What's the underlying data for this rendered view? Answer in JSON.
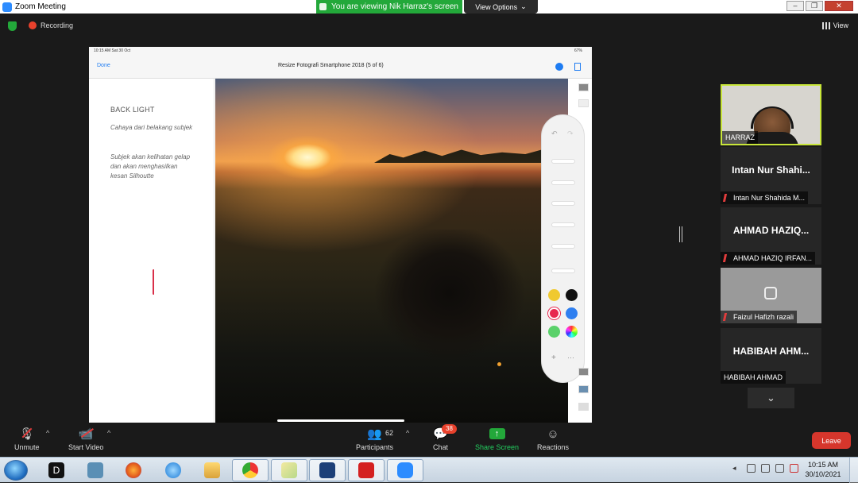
{
  "window": {
    "title": "Zoom Meeting",
    "banner": "You are viewing Nik Harraz's screen",
    "view_options": "View Options"
  },
  "meeting_top": {
    "recording_label": "Recording",
    "view_label": "View"
  },
  "shared_screen": {
    "status_time": "10:15 AM  Sat 30 Oct",
    "status_battery": "67%",
    "nav_done": "Done",
    "doc_title": "Resize Fotografi Smartphone 2018 (5 of 6)",
    "side_heading": "BACK LIGHT",
    "side_para1": "Cahaya dari belakang subjek",
    "side_para2": "Subjek akan kelihatan gelap dan akan menghasilkan kesan Silhoutte",
    "palette_colors": [
      "#f0c92f",
      "#111111",
      "#e8294f",
      "#2f7ff0",
      "#5ad16a"
    ]
  },
  "participants": [
    {
      "display": "",
      "name": "HARRAZ",
      "muted": false,
      "active": true
    },
    {
      "display": "Intan Nur Shahi...",
      "name": "Intan Nur Shahida M...",
      "muted": true
    },
    {
      "display": "AHMAD HAZIQ...",
      "name": "AHMAD HAZIQ IRFAN...",
      "muted": true
    },
    {
      "display": "",
      "name": "Faizul Hafizh razali",
      "muted": true
    },
    {
      "display": "HABIBAH AHM...",
      "name": "HABIBAH AHMAD",
      "muted": false
    }
  ],
  "controls": {
    "unmute": "Unmute",
    "start_video": "Start Video",
    "participants": "Participants",
    "participants_count": "62",
    "chat": "Chat",
    "chat_badge": "38",
    "share_screen": "Share Screen",
    "reactions": "Reactions",
    "leave": "Leave"
  },
  "taskbar": {
    "clock_time": "10:15 AM",
    "clock_date": "30/10/2021"
  },
  "colors": {
    "banner_green": "#23a83a",
    "leave_red": "#d6362c",
    "active_speaker_border": "#c8e639"
  }
}
